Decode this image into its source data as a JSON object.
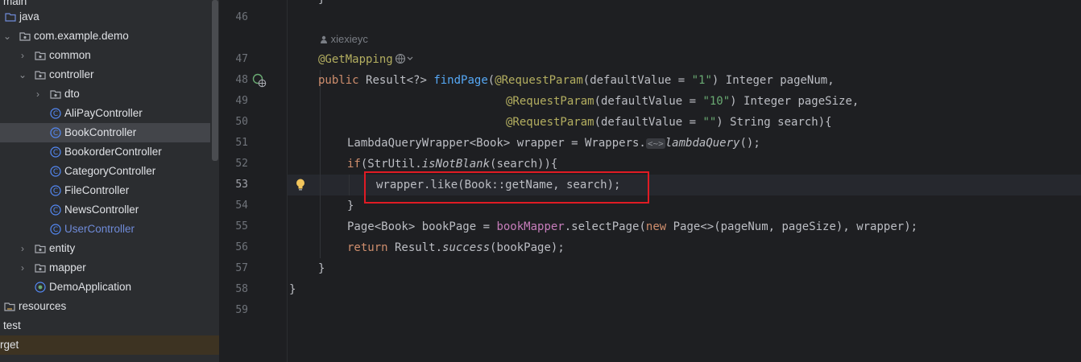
{
  "project_tree": {
    "items": [
      {
        "label": "main",
        "icon": "folder-icon"
      },
      {
        "label": "java",
        "icon": "folder-icon"
      },
      {
        "label": "com.example.demo",
        "icon": "package-icon"
      },
      {
        "label": "common",
        "icon": "package-icon"
      },
      {
        "label": "controller",
        "icon": "package-icon"
      },
      {
        "label": "dto",
        "icon": "package-icon"
      },
      {
        "label": "AliPayController",
        "icon": "class-icon"
      },
      {
        "label": "BookController",
        "icon": "class-icon"
      },
      {
        "label": "BookorderController",
        "icon": "class-icon"
      },
      {
        "label": "CategoryController",
        "icon": "class-icon"
      },
      {
        "label": "FileController",
        "icon": "class-icon"
      },
      {
        "label": "NewsController",
        "icon": "class-icon"
      },
      {
        "label": "UserController",
        "icon": "class-icon"
      },
      {
        "label": "entity",
        "icon": "package-icon"
      },
      {
        "label": "mapper",
        "icon": "package-icon"
      },
      {
        "label": "DemoApplication",
        "icon": "spring-app-icon"
      },
      {
        "label": "resources",
        "icon": "resources-folder-icon"
      },
      {
        "label": "test",
        "icon": "folder-icon"
      },
      {
        "label": "rget",
        "icon": "folder-icon"
      }
    ],
    "selected": "BookController"
  },
  "editor": {
    "line_numbers": [
      "46",
      "47",
      "48",
      "49",
      "50",
      "51",
      "52",
      "53",
      "54",
      "55",
      "56",
      "57",
      "58",
      "59"
    ],
    "current_line": "53",
    "author_hint": "xiexieyc",
    "code": {
      "l47_annotation": "@GetMapping",
      "l48_public": "public ",
      "l48_result": "Result<?> ",
      "l48_method": "findPage",
      "l48_paren": "(",
      "l48_rp": "@RequestParam",
      "l48_dv": "(defaultValue = ",
      "l48_str": "\"1\"",
      "l48_tail": ") Integer pageNum,",
      "l49_rp": "@RequestParam",
      "l49_dv": "(defaultValue = ",
      "l49_str": "\"10\"",
      "l49_tail": ") Integer pageSize,",
      "l50_rp": "@RequestParam",
      "l50_dv": "(defaultValue = ",
      "l50_str": "\"\"",
      "l50_tail": ") String search){",
      "l51_a": "LambdaQueryWrapper<Book> wrapper = Wrappers.",
      "l51_hint": "<~>",
      "l51_b": "lambdaQuery",
      "l51_c": "();",
      "l52_if": "if",
      "l52_a": "(StrUtil.",
      "l52_b": "isNotBlank",
      "l52_c": "(search)){",
      "l53": "wrapper.like(Book::getName, search);",
      "l54": "}",
      "l55_a": "Page<Book> bookPage = ",
      "l55_field": "bookMapper",
      "l55_b": ".selectPage(",
      "l55_new": "new",
      "l55_c": " Page<>(pageNum, pageSize), wrapper);",
      "l56_ret": "return",
      "l56_a": " Result.",
      "l56_b": "success",
      "l56_c": "(bookPage);",
      "l57": "}",
      "l58": "}",
      "l45_tail": "}"
    }
  },
  "colors": {
    "highlight_box": "#e01b24",
    "keyword": "#cf8e6d",
    "annotation": "#b3ae60",
    "method": "#56a8f5",
    "string": "#6aab73"
  }
}
